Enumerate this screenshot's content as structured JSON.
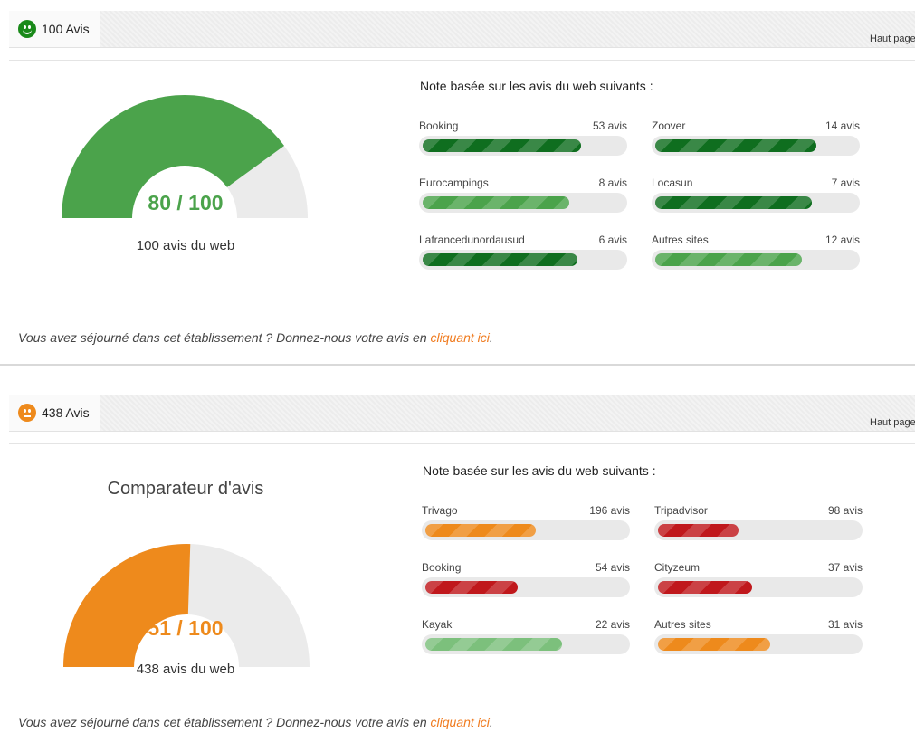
{
  "colors": {
    "green": "#4ba34b",
    "dark_green": "#0f6e1f",
    "light_green": "#7cc07c",
    "orange": "#ee8a1c",
    "red": "#c0181c",
    "track": "#e9e9e9",
    "link": "#f07b1f"
  },
  "block1": {
    "header": {
      "icon": "happy-smiley-icon",
      "count_label": "100 Avis",
      "top_link": "Haut page"
    },
    "gauge": {
      "score_label": "80 / 100",
      "score_fraction": 0.8,
      "subtitle": "100 avis du web",
      "color": "#4ba34b"
    },
    "sources_title": "Note basée sur les avis du web suivants :",
    "sources": [
      {
        "name": "Booking",
        "count": "53 avis",
        "fill": 0.79,
        "color": "#0f6e1f"
      },
      {
        "name": "Zoover",
        "count": "14 avis",
        "fill": 0.8,
        "color": "#0f6e1f"
      },
      {
        "name": "Eurocampings",
        "count": "8 avis",
        "fill": 0.73,
        "color": "#4ba34b"
      },
      {
        "name": "Locasun",
        "count": "7 avis",
        "fill": 0.78,
        "color": "#0f6e1f"
      },
      {
        "name": "Lafrancedunordausud",
        "count": "6 avis",
        "fill": 0.77,
        "color": "#0f6e1f"
      },
      {
        "name": "Autres sites",
        "count": "12 avis",
        "fill": 0.73,
        "color": "#4ba34b"
      }
    ],
    "footer": {
      "prefix": "Vous avez séjourné dans cet établissement ? Donnez-nous votre avis en ",
      "link": "cliquant ici",
      "suffix": "."
    }
  },
  "block2": {
    "header": {
      "icon": "neutral-smiley-icon",
      "count_label": "438 Avis",
      "top_link": "Haut page"
    },
    "gauge": {
      "title": "Comparateur d'avis",
      "score_label": "51 / 100",
      "score_fraction": 0.51,
      "subtitle": "438 avis du web",
      "color": "#ee8a1c"
    },
    "sources_title": "Note basée sur les avis du web suivants :",
    "sources": [
      {
        "name": "Trivago",
        "count": "196 avis",
        "fill": 0.55,
        "color": "#ee8a1c"
      },
      {
        "name": "Tripadvisor",
        "count": "98 avis",
        "fill": 0.4,
        "color": "#c0181c"
      },
      {
        "name": "Booking",
        "count": "54 avis",
        "fill": 0.46,
        "color": "#c0181c"
      },
      {
        "name": "Cityzeum",
        "count": "37 avis",
        "fill": 0.47,
        "color": "#c0181c"
      },
      {
        "name": "Kayak",
        "count": "22 avis",
        "fill": 0.68,
        "color": "#7cc07c"
      },
      {
        "name": "Autres sites",
        "count": "31 avis",
        "fill": 0.56,
        "color": "#ee8a1c"
      }
    ],
    "footer": {
      "prefix": "Vous avez séjourné dans cet établissement ? Donnez-nous votre avis en ",
      "link": "cliquant ici",
      "suffix": "."
    }
  }
}
